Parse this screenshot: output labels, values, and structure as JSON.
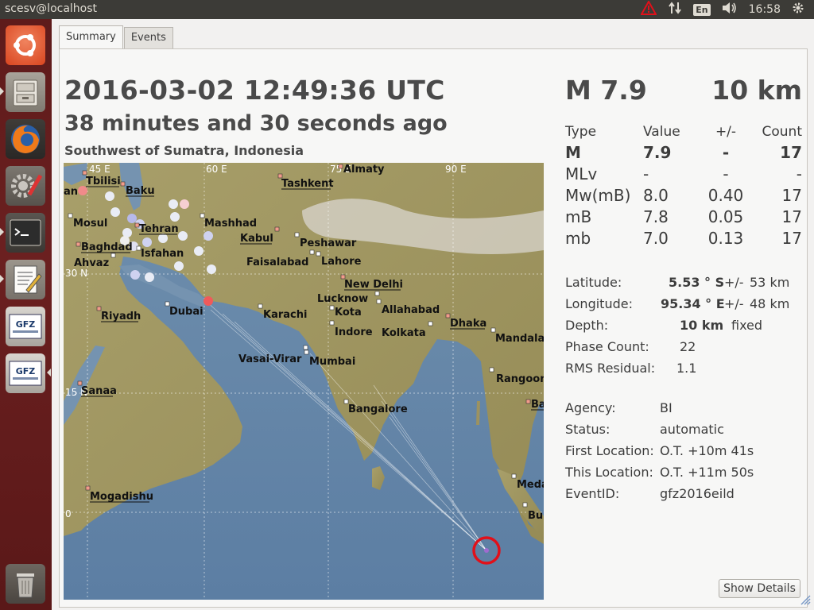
{
  "topbar": {
    "title": "scesv@localhost",
    "lang": "En",
    "time": "16:58"
  },
  "launcher": {
    "items": [
      {
        "name": "ubuntu-dash-button"
      },
      {
        "name": "files-button"
      },
      {
        "name": "firefox-button"
      },
      {
        "name": "system-settings-button"
      },
      {
        "name": "terminal-button"
      },
      {
        "name": "text-editor-button"
      },
      {
        "name": "gfz-app-button-1",
        "label": "GFZ"
      },
      {
        "name": "gfz-app-button-2",
        "label": "GFZ"
      },
      {
        "name": "trash-button"
      }
    ]
  },
  "tabs": {
    "summary": "Summary",
    "events": "Events"
  },
  "event": {
    "datetime": "2016-03-02 12:49:36 UTC",
    "ago": "38 minutes and 30 seconds ago",
    "region": "Southwest of Sumatra, Indonesia",
    "magnitude": "M 7.9",
    "depth_big": "10 km"
  },
  "magnitudes": {
    "headers": [
      "Type",
      "Value",
      "+/-",
      "Count"
    ],
    "rows": [
      [
        "M",
        "7.9",
        "-",
        "17"
      ],
      [
        "MLv",
        "-",
        "-",
        "-"
      ],
      [
        "Mw(mB)",
        "8.0",
        "0.40",
        "17"
      ],
      [
        "mB",
        "7.8",
        "0.05",
        "17"
      ],
      [
        "mb",
        "7.0",
        "0.13",
        "17"
      ]
    ]
  },
  "location": {
    "latitude_label": "Latitude:",
    "latitude": "5.53 ° S",
    "latitude_pm": "+/-",
    "latitude_unc": "53 km",
    "longitude_label": "Longitude:",
    "longitude": "95.34 ° E",
    "longitude_pm": "+/-",
    "longitude_unc": "48 km",
    "depth_label": "Depth:",
    "depth": "10 km",
    "depth_type": "fixed",
    "phase_label": "Phase Count:",
    "phase": "22",
    "rms_label": "RMS Residual:",
    "rms": "1.1"
  },
  "origin": {
    "agency_label": "Agency:",
    "agency": "BI",
    "status_label": "Status:",
    "status": "automatic",
    "first_label": "First Location:",
    "first": "O.T. +10m 41s",
    "this_label": "This Location:",
    "this": "O.T. +11m 50s",
    "eventid_label": "EventID:",
    "eventid": "gfz2016eild"
  },
  "map": {
    "grid_labels": [
      "45 E",
      "60 E",
      "75 E",
      "90 E",
      "30 N",
      "15 N",
      "0"
    ],
    "cities": [
      {
        "name": "Almaty",
        "underline": false
      },
      {
        "name": "Tbilisi",
        "underline": true
      },
      {
        "name": "Baku",
        "underline": true
      },
      {
        "name": "Tashkent",
        "underline": true
      },
      {
        "name": "an",
        "underline": false
      },
      {
        "name": "Mosul",
        "underline": false
      },
      {
        "name": "Mashhad",
        "underline": false
      },
      {
        "name": "Tehran",
        "underline": true
      },
      {
        "name": "Kabul",
        "underline": true
      },
      {
        "name": "Peshawar",
        "underline": false
      },
      {
        "name": "Baghdad",
        "underline": true
      },
      {
        "name": "Isfahan",
        "underline": false
      },
      {
        "name": "Ahvaz",
        "underline": false
      },
      {
        "name": "Faisalabad",
        "underline": false
      },
      {
        "name": "Lahore",
        "underline": false
      },
      {
        "name": "New Delhi",
        "underline": true
      },
      {
        "name": "Riyadh",
        "underline": true
      },
      {
        "name": "Dubai",
        "underline": false
      },
      {
        "name": "Karachi",
        "underline": false
      },
      {
        "name": "Lucknow",
        "underline": false
      },
      {
        "name": "Kota",
        "underline": false
      },
      {
        "name": "Allahabad",
        "underline": false
      },
      {
        "name": "Indore",
        "underline": false
      },
      {
        "name": "Kolkata",
        "underline": false
      },
      {
        "name": "Dhaka",
        "underline": true
      },
      {
        "name": "Mandala",
        "underline": false
      },
      {
        "name": "Vasai-Virar",
        "underline": false
      },
      {
        "name": "Mumbai",
        "underline": false
      },
      {
        "name": "Rangoon",
        "underline": false
      },
      {
        "name": "Sanaa",
        "underline": true
      },
      {
        "name": "Ba",
        "underline": true
      },
      {
        "name": "Bangalore",
        "underline": false
      },
      {
        "name": "Mogadishu",
        "underline": true
      },
      {
        "name": "Meda",
        "underline": false
      },
      {
        "name": "Bu",
        "underline": false
      }
    ]
  },
  "buttons": {
    "show_details": "Show Details"
  },
  "colors": {
    "accent_red": "#e1101a",
    "launcher": "#5e1b1b",
    "panel": "#3c3b37"
  }
}
